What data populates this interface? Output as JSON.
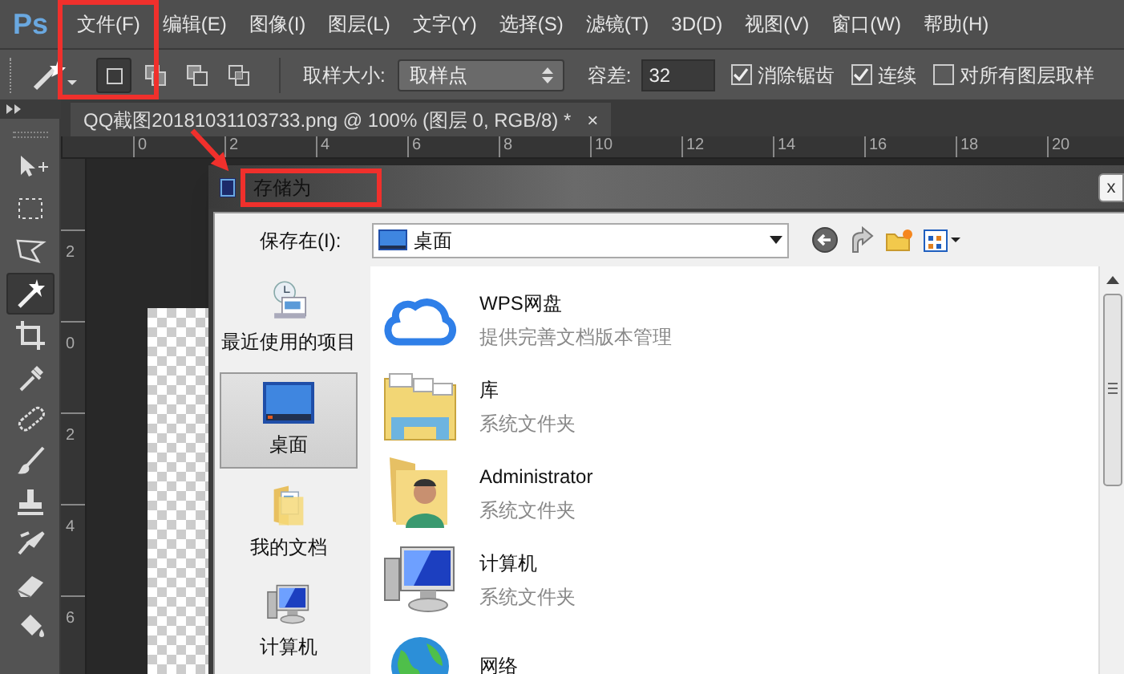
{
  "app": {
    "logo": "Ps"
  },
  "menus": [
    {
      "label": "文件(F)",
      "highlighted": true
    },
    {
      "label": "编辑(E)",
      "highlighted": false
    },
    {
      "label": "图像(I)",
      "highlighted": false
    },
    {
      "label": "图层(L)",
      "highlighted": false
    },
    {
      "label": "文字(Y)",
      "highlighted": false
    },
    {
      "label": "选择(S)",
      "highlighted": false
    },
    {
      "label": "滤镜(T)",
      "highlighted": false
    },
    {
      "label": "3D(D)",
      "highlighted": false
    },
    {
      "label": "视图(V)",
      "highlighted": false
    },
    {
      "label": "窗口(W)",
      "highlighted": false
    },
    {
      "label": "帮助(H)",
      "highlighted": false
    }
  ],
  "options_bar": {
    "selection_modes": [
      {
        "selected": true
      },
      {
        "selected": false
      },
      {
        "selected": false
      },
      {
        "selected": false
      }
    ],
    "sample_size_label": "取样大小:",
    "sample_size_value": "取样点",
    "tolerance_label": "容差:",
    "tolerance_value": "32",
    "checkboxes": [
      {
        "label": "消除锯齿",
        "checked": true
      },
      {
        "label": "连续",
        "checked": true
      },
      {
        "label": "对所有图层取样",
        "checked": false
      }
    ]
  },
  "document_tab": {
    "title": "QQ截图20181031103733.png @ 100% (图层 0, RGB/8) *",
    "close": "×"
  },
  "rulers": {
    "horizontal": [
      "0",
      "2",
      "4",
      "6",
      "8",
      "10",
      "12",
      "14",
      "16",
      "18",
      "20"
    ],
    "vertical": [
      "2",
      "0",
      "2",
      "4",
      "6"
    ]
  },
  "tools": [
    {
      "kind": "move",
      "selected": false
    },
    {
      "kind": "marquee",
      "selected": false
    },
    {
      "kind": "lasso",
      "selected": false
    },
    {
      "kind": "wand",
      "selected": true
    },
    {
      "kind": "crop",
      "selected": false
    },
    {
      "kind": "eyedropper",
      "selected": false
    },
    {
      "kind": "heal",
      "selected": false
    },
    {
      "kind": "brush",
      "selected": false
    },
    {
      "kind": "stamp",
      "selected": false
    },
    {
      "kind": "history",
      "selected": false
    },
    {
      "kind": "eraser",
      "selected": false
    },
    {
      "kind": "bucket",
      "selected": false
    }
  ],
  "dialog": {
    "title": "存储为",
    "title_highlighted": true,
    "close": "x",
    "save_in_label": "保存在(I):",
    "save_in_value": "桌面",
    "places": [
      {
        "kind": "recent",
        "label": "最近使用的项目",
        "selected": false
      },
      {
        "kind": "desktop",
        "label": "桌面",
        "selected": true
      },
      {
        "kind": "documents",
        "label": "我的文档",
        "selected": false
      },
      {
        "kind": "computer",
        "label": "计算机",
        "selected": false
      }
    ],
    "items": [
      {
        "kind": "cloud",
        "name": "WPS网盘",
        "description": "提供完善文档版本管理"
      },
      {
        "kind": "library",
        "name": "库",
        "description": "系统文件夹"
      },
      {
        "kind": "user",
        "name": "Administrator",
        "description": "系统文件夹"
      },
      {
        "kind": "computer",
        "name": "计算机",
        "description": "系统文件夹"
      },
      {
        "kind": "network",
        "name": "网络"
      }
    ]
  }
}
